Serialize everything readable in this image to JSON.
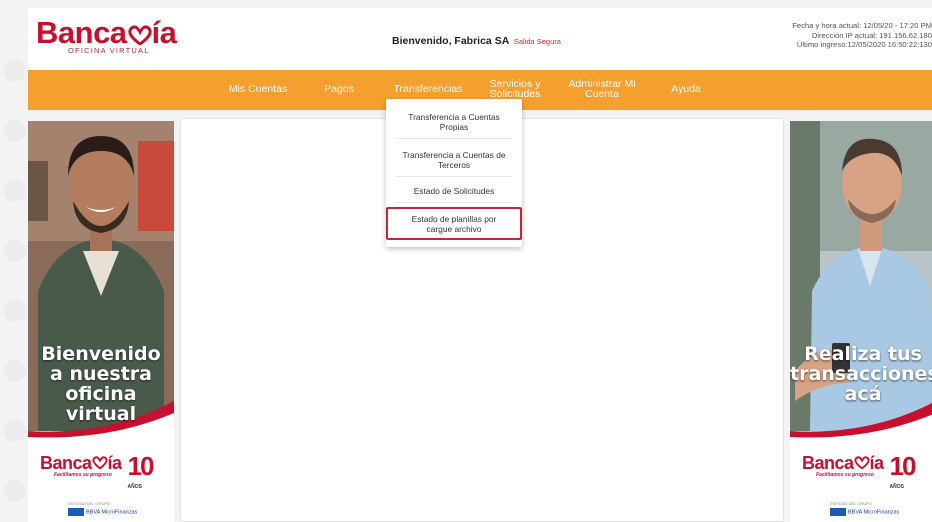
{
  "header": {
    "logo_text": "Bancamía",
    "logo_word_left": "Banca",
    "logo_word_right": "ía",
    "logo_subtitle": "OFICINA VIRTUAL",
    "welcome_text": "Bienvenido, Fabrica SA",
    "exit_link": "Salida Segura",
    "session_line_1": "Fecha y hora actual: 12/05/20 - 17:20 PM",
    "session_line_2": "Dirección IP actual: 191.156.62.180",
    "session_line_3": "Último ingreso:12/05/2020 16:50:22:130"
  },
  "nav": {
    "items": [
      {
        "label": "Mis Cuentas"
      },
      {
        "label": "Pagos"
      },
      {
        "label": "Transferencias"
      },
      {
        "label_1": "Servicios y",
        "label_2": "Solicitudes"
      },
      {
        "label_1": "Administrar Mi",
        "label_2": "Cuenta"
      },
      {
        "label": "Ayuda"
      }
    ]
  },
  "dropdown": {
    "items": [
      {
        "line_1": "Transferencia a Cuentas",
        "line_2": "Propias"
      },
      {
        "line_1": "Transferencia a Cuentas de",
        "line_2": "Terceros"
      },
      {
        "line_1": "Estado de Solicitudes"
      },
      {
        "line_1": "Estado de planillas por",
        "line_2": "cargue archivo"
      }
    ]
  },
  "left_banner": {
    "line_1": "Bienvenido",
    "line_2": "a nuestra",
    "line_3": "oficina virtual",
    "logo_word_left": "Banca",
    "logo_word_right": "ía",
    "tagline": "Facilitamos su progreso",
    "years": "10",
    "years_label": "AÑOS",
    "partner_top": "ENTIDAD DEL GRUPO",
    "partner_name": "BBVA MicroFinanzas"
  },
  "right_banner": {
    "line_1": "Realiza tus",
    "line_2": "transacciones",
    "line_3": "acá",
    "logo_word_left": "Banca",
    "logo_word_right": "ía",
    "tagline": "Facilitamos su progreso",
    "years": "10",
    "years_label": "AÑOS",
    "partner_top": "ENTIDAD DEL GRUPO",
    "partner_name": "BBVA MicroFinanzas"
  },
  "colors": {
    "brand_red": "#c8102e",
    "nav_orange": "#f5a02e",
    "highlight_border": "#c0273a"
  }
}
